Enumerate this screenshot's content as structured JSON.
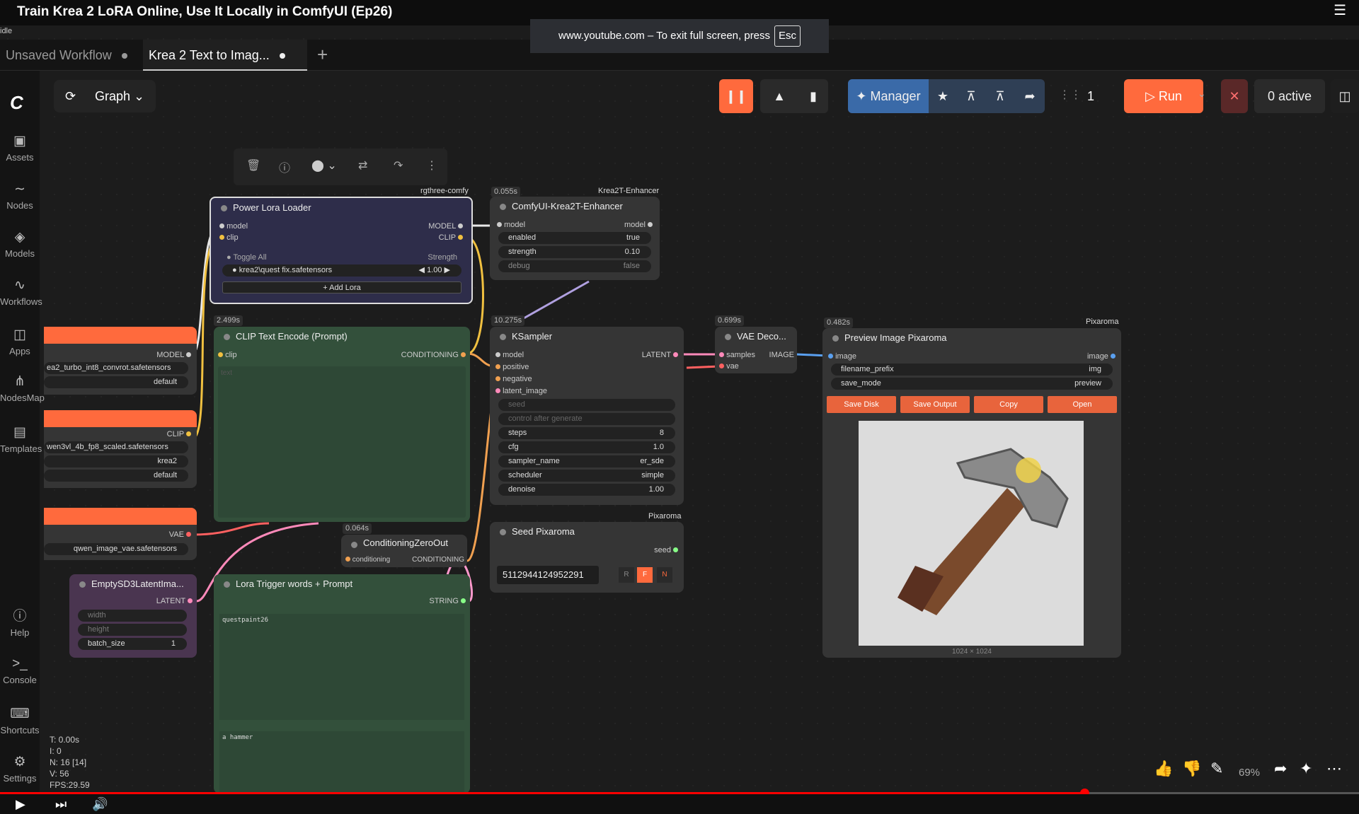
{
  "video": {
    "title": "Train Krea 2 LoRA Online, Use It Locally in ComfyUI (Ep26)",
    "fullscreen_notice": "www.youtube.com – To exit full screen, press",
    "fullscreen_key": "Esc",
    "status": "idle"
  },
  "tabs": [
    {
      "label": "Unsaved Workflow"
    },
    {
      "label": "Krea 2 Text to Imag..."
    }
  ],
  "graph_button": "Graph",
  "sidebar": [
    {
      "label": "Assets",
      "icon": "image-icon"
    },
    {
      "label": "Nodes",
      "icon": "nodes-icon"
    },
    {
      "label": "Models",
      "icon": "models-icon"
    },
    {
      "label": "Workflows",
      "icon": "workflows-icon"
    },
    {
      "label": "Apps",
      "icon": "apps-icon"
    },
    {
      "label": "NodesMap",
      "icon": "map-icon"
    },
    {
      "label": "Templates",
      "icon": "templates-icon"
    },
    {
      "label": "Help",
      "icon": "help-icon"
    },
    {
      "label": "Console",
      "icon": "console-icon"
    },
    {
      "label": "Shortcuts",
      "icon": "keyboard-icon"
    },
    {
      "label": "Settings",
      "icon": "gear-icon"
    }
  ],
  "toolbar": {
    "manager": "Manager",
    "batch": "1",
    "run": "Run",
    "active": "0 active"
  },
  "nodes": {
    "power_lora": {
      "title": "Power Lora Loader",
      "tag": "rgthree-comfy",
      "in_model": "model",
      "out_model": "MODEL",
      "in_clip": "clip",
      "out_clip": "CLIP",
      "toggle_all": "Toggle All",
      "strength": "Strength",
      "lora_name": "krea2\\quest fix.safetensors",
      "lora_strength": "1.00",
      "add_lora": "+ Add Lora"
    },
    "enhancer": {
      "title": "ComfyUI-Krea2T-Enhancer",
      "time": "0.055s",
      "tag": "Krea2T-Enhancer",
      "in_model": "model",
      "out_model": "model",
      "enabled_label": "enabled",
      "enabled_value": "true",
      "strength_label": "strength",
      "strength_value": "0.10",
      "debug_label": "debug",
      "debug_value": "false"
    },
    "clip_encode": {
      "title": "CLIP Text Encode (Prompt)",
      "time": "2.499s",
      "in_clip": "clip",
      "out": "CONDITIONING",
      "placeholder": "text"
    },
    "ksampler": {
      "title": "KSampler",
      "time": "10.275s",
      "inputs": [
        "model",
        "positive",
        "negative",
        "latent_image"
      ],
      "out": "LATENT",
      "seed": "seed",
      "control": "control after generate",
      "widgets": [
        {
          "label": "steps",
          "value": "8"
        },
        {
          "label": "cfg",
          "value": "1.0"
        },
        {
          "label": "sampler_name",
          "value": "er_sde"
        },
        {
          "label": "scheduler",
          "value": "simple"
        },
        {
          "label": "denoise",
          "value": "1.00"
        }
      ],
      "footer_tag": "Pixaroma"
    },
    "vae_decode": {
      "title": "VAE Deco...",
      "time": "0.699s",
      "in_samples": "samples",
      "in_vae": "vae",
      "out": "IMAGE"
    },
    "preview": {
      "title": "Preview Image Pixaroma",
      "time": "0.482s",
      "tag": "Pixaroma",
      "in_image": "image",
      "out_image": "image",
      "prefix_label": "filename_prefix",
      "prefix_value": "img",
      "mode_label": "save_mode",
      "mode_value": "preview",
      "buttons": [
        "Save Disk",
        "Save Output",
        "Copy",
        "Open"
      ],
      "dims": "1024 × 1024"
    },
    "loaders": {
      "model_out": "MODEL",
      "model_name": "ea2_turbo_int8_convrot.safetensors",
      "model_dtype": "default",
      "clip_out": "CLIP",
      "clip_name": "wen3vl_4b_fp8_scaled.safetensors",
      "clip_type": "krea2",
      "clip_device": "default",
      "vae_out": "VAE",
      "vae_name": "qwen_image_vae.safetensors"
    },
    "empty_latent": {
      "title": "EmptySD3LatentIma...",
      "out": "LATENT",
      "width": "width",
      "height": "height",
      "batch_label": "batch_size",
      "batch_value": "1"
    },
    "zero_out": {
      "title": "ConditioningZeroOut",
      "time": "0.064s",
      "in": "conditioning",
      "out": "CONDITIONING"
    },
    "seed": {
      "title": "Seed Pixaroma",
      "out": "seed",
      "value": "5112944124952291",
      "btn_r": "R",
      "btn_f": "F",
      "btn_n": "N"
    },
    "lora_trigger": {
      "title": "Lora Trigger words + Prompt",
      "out": "STRING",
      "text1": "questpaint26",
      "text2": "a hammer"
    }
  },
  "stats": {
    "t": "T: 0.00s",
    "i": "I: 0",
    "n": "N: 16 [14]",
    "v": "V: 56",
    "fps": "FPS:29.59"
  },
  "zoom": "69%",
  "progress": 0.798
}
